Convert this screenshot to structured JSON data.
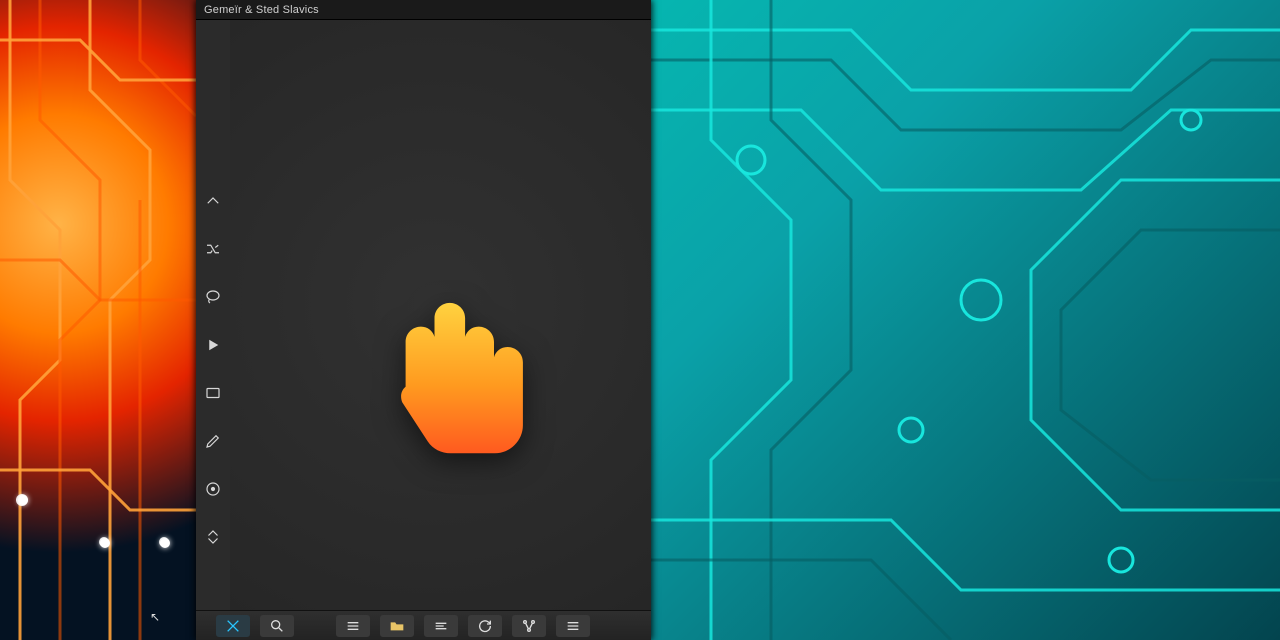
{
  "window": {
    "title": "Gemeïr & Sted Slavics"
  },
  "tools": [
    {
      "id": "move-up",
      "icon": "chevron-up"
    },
    {
      "id": "shuffle",
      "icon": "shuffle"
    },
    {
      "id": "lasso",
      "icon": "loop"
    },
    {
      "id": "play",
      "icon": "play"
    },
    {
      "id": "rectangle",
      "icon": "rect"
    },
    {
      "id": "pen",
      "icon": "pen"
    },
    {
      "id": "target",
      "icon": "target"
    },
    {
      "id": "collapse",
      "icon": "chevrons"
    }
  ],
  "canvas": {
    "object": "hand-icon",
    "gradient_from": "#ffd23f",
    "gradient_to": "#ff5a1f"
  },
  "taskbar": {
    "group_a": [
      {
        "id": "app-editor",
        "icon": "cross-arrows",
        "active": true
      },
      {
        "id": "app-search",
        "icon": "zoom"
      }
    ],
    "group_b": [
      {
        "id": "app-lines",
        "icon": "hlines"
      },
      {
        "id": "app-files",
        "icon": "folder"
      },
      {
        "id": "app-layers",
        "icon": "stack"
      },
      {
        "id": "app-rotate",
        "icon": "rotate"
      },
      {
        "id": "app-network",
        "icon": "branch"
      },
      {
        "id": "app-menu",
        "icon": "hlines"
      }
    ]
  },
  "colors": {
    "accent_cyan": "#18e6dd",
    "accent_amber": "#ffa23a",
    "taskbar_active": "#29c5ff"
  }
}
